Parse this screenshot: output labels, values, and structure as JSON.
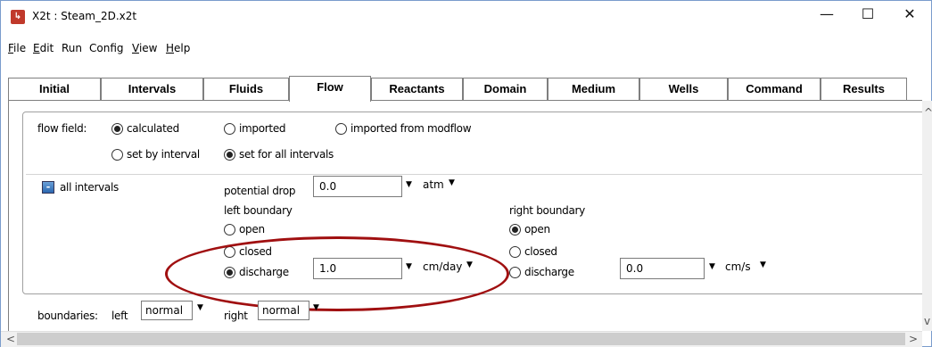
{
  "window": {
    "title": "X2t : Steam_2D.x2t",
    "icon": "x2t-app-icon",
    "minimize_glyph": "—",
    "maximize_glyph": "☐",
    "close_glyph": "✕"
  },
  "menu": [
    {
      "label": "File",
      "mnemonic": "F",
      "rest": "ile"
    },
    {
      "label": "Edit",
      "mnemonic": "E",
      "rest": "dit"
    },
    {
      "label": "Run",
      "mnemonic": "",
      "rest": "Run"
    },
    {
      "label": "Config",
      "mnemonic": "",
      "rest": "Config"
    },
    {
      "label": "View",
      "mnemonic": "V",
      "rest": "iew"
    },
    {
      "label": "Help",
      "mnemonic": "H",
      "rest": "elp"
    }
  ],
  "tabs": [
    {
      "label": "Initial"
    },
    {
      "label": "Intervals"
    },
    {
      "label": "Fluids"
    },
    {
      "label": "Flow",
      "active": true
    },
    {
      "label": "Reactants"
    },
    {
      "label": "Domain"
    },
    {
      "label": "Medium"
    },
    {
      "label": "Wells"
    },
    {
      "label": "Command"
    },
    {
      "label": "Results"
    }
  ],
  "flow_field": {
    "label": "flow field:",
    "options": {
      "calculated": {
        "label": "calculated",
        "selected": true
      },
      "imported": {
        "label": "imported",
        "selected": false
      },
      "imported_modflow": {
        "label": "imported from modflow",
        "selected": false
      },
      "set_by_interval": {
        "label": "set by interval",
        "selected": false
      },
      "set_for_all": {
        "label": "set for all intervals",
        "selected": true
      }
    }
  },
  "intervals": {
    "collapse_glyph": "-",
    "label": "all intervals"
  },
  "potential_drop": {
    "label": "potential drop",
    "value": "0.0",
    "unit": "atm"
  },
  "left_boundary": {
    "label": "left boundary",
    "open": {
      "label": "open",
      "selected": false
    },
    "closed": {
      "label": "closed",
      "selected": false
    },
    "discharge": {
      "label": "discharge",
      "selected": true
    },
    "discharge_value": "1.0",
    "discharge_unit": "cm/day"
  },
  "right_boundary": {
    "label": "right boundary",
    "open": {
      "label": "open",
      "selected": true
    },
    "closed": {
      "label": "closed",
      "selected": false
    },
    "discharge": {
      "label": "discharge",
      "selected": false
    },
    "discharge_value": "0.0",
    "discharge_unit": "cm/s"
  },
  "boundaries": {
    "label": "boundaries:",
    "left_label": "left",
    "left_value": "normal",
    "right_label": "right",
    "right_value": "normal"
  },
  "dropdown_glyph": "▼",
  "scroll": {
    "up": "^",
    "down": "v",
    "left": "<",
    "right": ">"
  },
  "colors": {
    "annotation_ellipse": "#a00f10",
    "window_border": "#7a9ccc"
  }
}
